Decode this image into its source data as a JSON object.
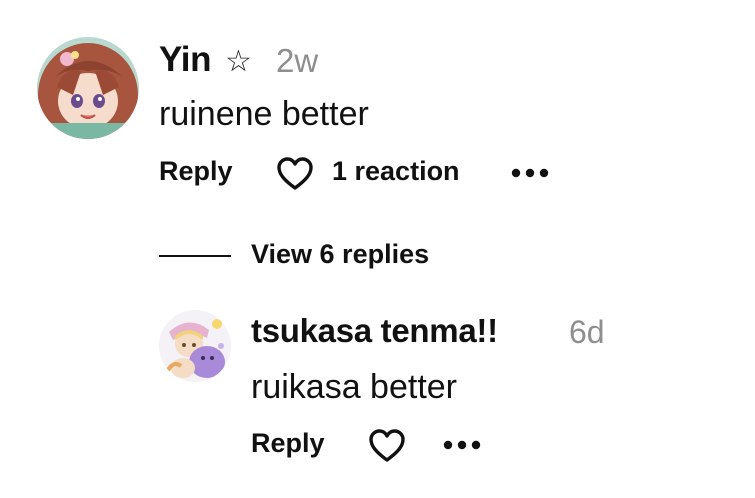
{
  "comment": {
    "author": "Yin",
    "badge_icon": "star-outline-icon",
    "badge_glyph": "☆",
    "time": "2w",
    "text": "ruinene better",
    "reply_label": "Reply",
    "like_icon": "heart-outline-icon",
    "reaction_label": "1 reaction",
    "more_icon": "more-horizontal-icon"
  },
  "replies_toggle": {
    "label": "View 6 replies"
  },
  "reply": {
    "author": "tsukasa tenma!!",
    "time": "6d",
    "text": "ruikasa better",
    "reply_label": "Reply",
    "like_icon": "heart-outline-icon",
    "more_icon": "more-horizontal-icon"
  },
  "colors": {
    "text": "#111111",
    "muted": "#8e8e8e",
    "background": "#ffffff"
  }
}
